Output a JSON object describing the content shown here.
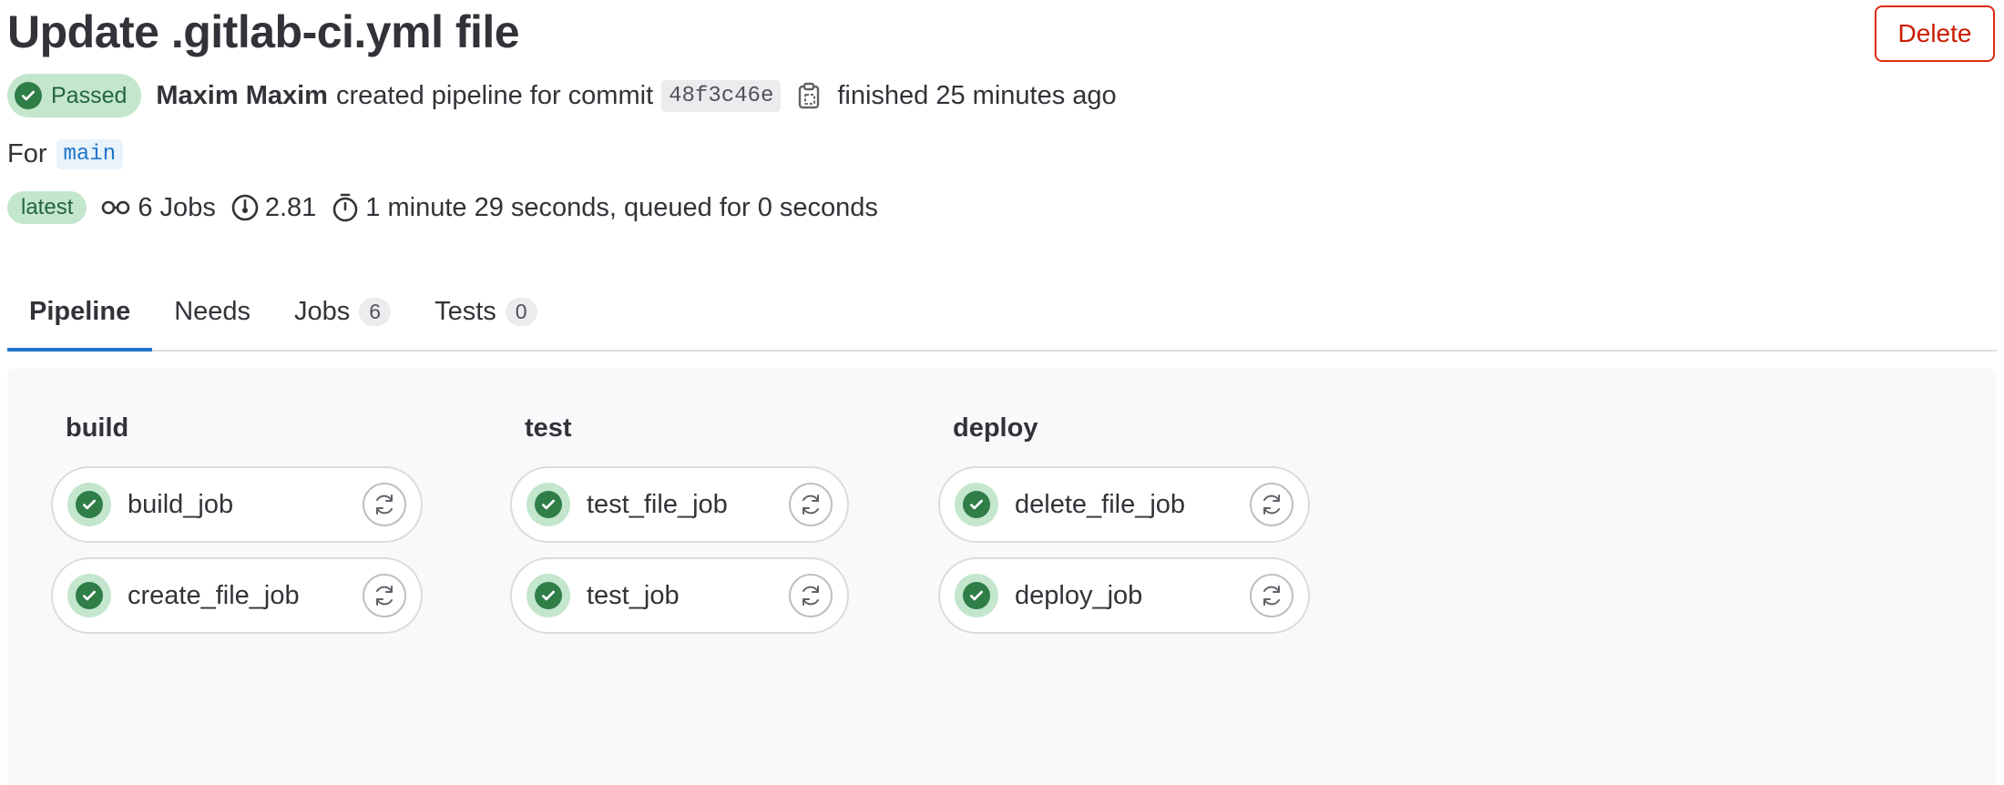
{
  "header": {
    "title": "Update .gitlab-ci.yml file",
    "delete_label": "Delete"
  },
  "meta": {
    "status_label": "Passed",
    "author": "Maxim Maxim",
    "action_text": "created pipeline for commit",
    "commit_sha": "48f3c46e",
    "finished_text": "finished 25 minutes ago"
  },
  "ref": {
    "prefix": "For",
    "branch": "main"
  },
  "stats": {
    "latest_label": "latest",
    "jobs_text": "6 Jobs",
    "compute_text": "2.81",
    "duration_text": "1 minute 29 seconds, queued for 0 seconds"
  },
  "tabs": [
    {
      "label": "Pipeline",
      "count": ""
    },
    {
      "label": "Needs",
      "count": ""
    },
    {
      "label": "Jobs",
      "count": "6"
    },
    {
      "label": "Tests",
      "count": "0"
    }
  ],
  "stages": [
    {
      "name": "build",
      "jobs": [
        {
          "name": "build_job"
        },
        {
          "name": "create_file_job"
        }
      ]
    },
    {
      "name": "test",
      "jobs": [
        {
          "name": "test_file_job"
        },
        {
          "name": "test_job"
        }
      ]
    },
    {
      "name": "deploy",
      "jobs": [
        {
          "name": "delete_file_job"
        },
        {
          "name": "deploy_job"
        }
      ]
    }
  ],
  "colors": {
    "success": "#2f7d47",
    "success_bg": "#c3e6cd",
    "danger": "#dd2b0e",
    "link": "#1f75cb"
  },
  "icons": {
    "status": "status-success-icon",
    "copy": "copy-to-clipboard-icon",
    "jobs": "pipeline-icon",
    "compute": "dashboard-icon",
    "duration": "timer-icon",
    "retry": "retry-icon"
  }
}
